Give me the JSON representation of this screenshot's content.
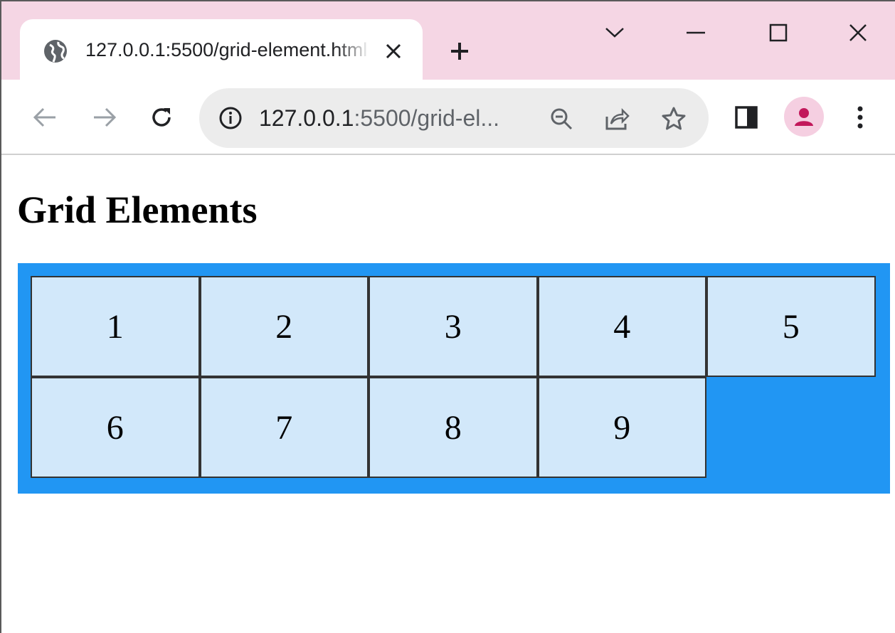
{
  "browser": {
    "tab": {
      "title": "127.0.0.1:5500/grid-element.html"
    },
    "address_bar": {
      "host": "127.0.0.1",
      "rest": ":5500/grid-el..."
    }
  },
  "colors": {
    "tabstrip": "#f5d6e4",
    "grid_background": "#2196f3",
    "grid_item": "#d2e8fa",
    "avatar_accent": "#c2185b"
  },
  "page": {
    "title": "Grid Elements",
    "grid_items": [
      "1",
      "2",
      "3",
      "4",
      "5",
      "6",
      "7",
      "8",
      "9"
    ]
  }
}
